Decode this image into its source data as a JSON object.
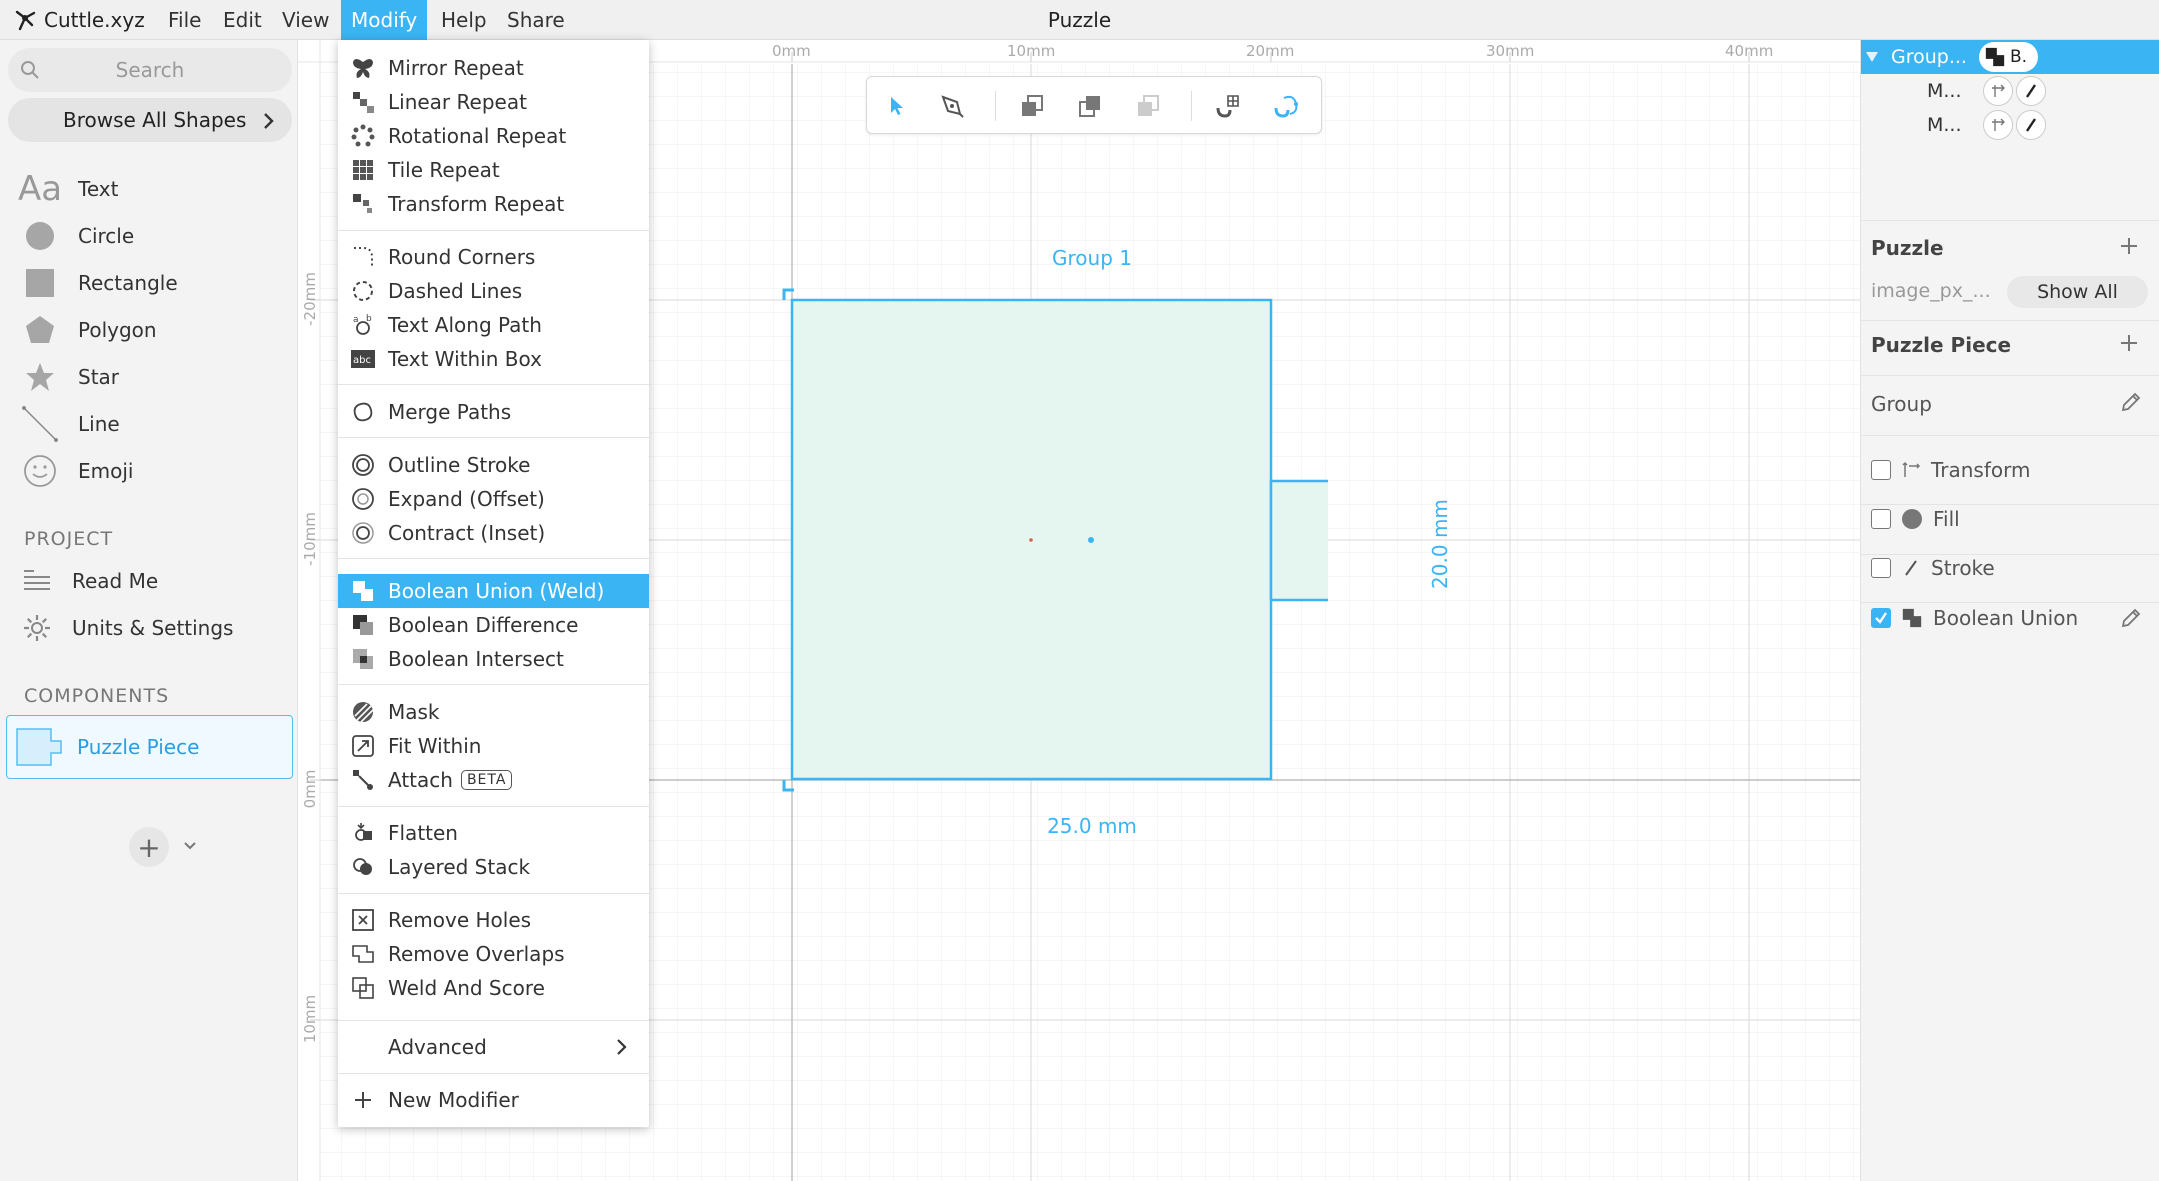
{
  "app": {
    "name": "Cuttle.xyz",
    "document_title": "Puzzle"
  },
  "menubar": [
    "File",
    "Edit",
    "View",
    "Modify",
    "Help",
    "Share"
  ],
  "left_sidebar": {
    "search_placeholder": "Search",
    "browse_label": "Browse All Shapes",
    "shapes": [
      {
        "label": "Text",
        "icon": "text-icon"
      },
      {
        "label": "Circle",
        "icon": "circle-icon"
      },
      {
        "label": "Rectangle",
        "icon": "rectangle-icon"
      },
      {
        "label": "Polygon",
        "icon": "polygon-icon"
      },
      {
        "label": "Star",
        "icon": "star-icon"
      },
      {
        "label": "Line",
        "icon": "line-icon"
      },
      {
        "label": "Emoji",
        "icon": "emoji-icon"
      }
    ],
    "project_header": "PROJECT",
    "project_items": [
      {
        "label": "Read Me",
        "icon": "list-icon"
      },
      {
        "label": "Units & Settings",
        "icon": "gear-icon"
      }
    ],
    "components_header": "COMPONENTS",
    "components": [
      {
        "label": "Puzzle Piece",
        "icon": "puzzle-piece-icon"
      }
    ]
  },
  "modify_menu": {
    "groups": [
      [
        {
          "label": "Mirror Repeat",
          "icon": "butterfly-icon"
        },
        {
          "label": "Linear Repeat",
          "icon": "linear-repeat-icon"
        },
        {
          "label": "Rotational Repeat",
          "icon": "rotational-repeat-icon"
        },
        {
          "label": "Tile Repeat",
          "icon": "tile-repeat-icon"
        },
        {
          "label": "Transform Repeat",
          "icon": "transform-repeat-icon"
        }
      ],
      [
        {
          "label": "Round Corners",
          "icon": "round-corners-icon"
        },
        {
          "label": "Dashed Lines",
          "icon": "dashed-circle-icon"
        },
        {
          "label": "Text Along Path",
          "icon": "text-path-icon"
        },
        {
          "label": "Text Within Box",
          "icon": "text-box-icon"
        }
      ],
      [
        {
          "label": "Merge Paths",
          "icon": "merge-paths-icon"
        }
      ],
      [
        {
          "label": "Outline Stroke",
          "icon": "outline-stroke-icon"
        },
        {
          "label": "Expand (Offset)",
          "icon": "expand-icon"
        },
        {
          "label": "Contract (Inset)",
          "icon": "contract-icon"
        }
      ],
      [
        {
          "label": "Boolean Union (Weld)",
          "icon": "boolean-union-icon",
          "highlighted": true
        },
        {
          "label": "Boolean Difference",
          "icon": "boolean-difference-icon"
        },
        {
          "label": "Boolean Intersect",
          "icon": "boolean-intersect-icon"
        }
      ],
      [
        {
          "label": "Mask",
          "icon": "mask-icon"
        },
        {
          "label": "Fit Within",
          "icon": "fit-within-icon"
        },
        {
          "label": "Attach",
          "icon": "attach-icon",
          "badge": "BETA"
        }
      ],
      [
        {
          "label": "Flatten",
          "icon": "flatten-icon"
        },
        {
          "label": "Layered Stack",
          "icon": "layered-stack-icon"
        }
      ],
      [
        {
          "label": "Remove Holes",
          "icon": "remove-holes-icon"
        },
        {
          "label": "Remove Overlaps",
          "icon": "remove-overlaps-icon"
        },
        {
          "label": "Weld And Score",
          "icon": "weld-score-icon"
        }
      ],
      [
        {
          "label": "Advanced",
          "icon": "",
          "submenu": true
        }
      ],
      [
        {
          "label": "New Modifier",
          "icon": "plus-icon"
        }
      ]
    ]
  },
  "canvas": {
    "ruler_top": [
      "0mm",
      "10mm",
      "20mm",
      "30mm",
      "40mm"
    ],
    "ruler_left": [
      "-20mm",
      "-10mm",
      "0mm",
      "10mm"
    ],
    "group_label": "Group 1",
    "width_label": "25.0 mm",
    "height_label": "20.0 mm",
    "accent": "#3ab4f2"
  },
  "toolbar": {
    "tools": [
      "select-arrow-icon",
      "pen-icon",
      "send-back-icon",
      "bring-front-icon",
      "group-icon",
      "magnet-grid-icon",
      "magnet-path-icon"
    ]
  },
  "right_panel": {
    "tree": {
      "selected_label": "Group...",
      "selected_pill": "B.",
      "children": [
        "M...",
        "M..."
      ]
    },
    "puzzle_header": "Puzzle",
    "param_label": "image_px_...",
    "show_all": "Show All",
    "piece_header": "Puzzle Piece",
    "group_label": "Group",
    "modifiers": [
      {
        "label": "Transform",
        "checked": false,
        "icon": "transform-icon"
      },
      {
        "label": "Fill",
        "checked": false,
        "icon": "fill-icon"
      },
      {
        "label": "Stroke",
        "checked": false,
        "icon": "stroke-icon"
      },
      {
        "label": "Boolean Union",
        "checked": true,
        "icon": "boolean-union-icon"
      }
    ]
  }
}
